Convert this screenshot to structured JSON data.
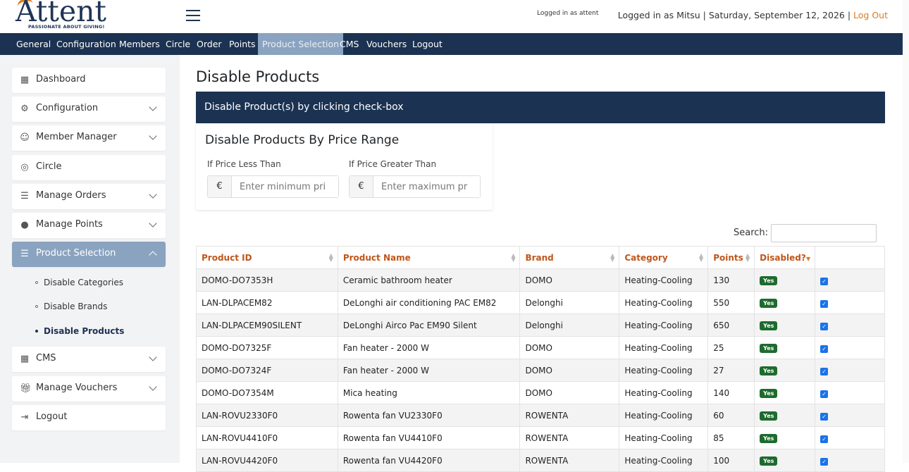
{
  "header": {
    "logo_word": "Attent",
    "logo_tagline": "PASSIONATE ABOUT GIVING!",
    "logged_small": "Logged in as attent",
    "logged_in_text": "Logged in as Mitsu | Saturday, September 12, 2026 |",
    "logout_link": "Log Out"
  },
  "nav": {
    "items": [
      "General",
      "Configuration",
      "Members",
      "Circle",
      "Order",
      "Points",
      "Product Selection",
      "CMS",
      "Vouchers",
      "Logout"
    ],
    "active": "Product Selection"
  },
  "sidebar": {
    "items": [
      {
        "label": "Dashboard",
        "icon": "grid-icon"
      },
      {
        "label": "Configuration",
        "icon": "gear-icon"
      },
      {
        "label": "Member Manager",
        "icon": "user-icon"
      },
      {
        "label": "Circle",
        "icon": "target-icon"
      },
      {
        "label": "Manage Orders",
        "icon": "list-icon"
      },
      {
        "label": "Manage Points",
        "icon": "coins-icon"
      },
      {
        "label": "Product Selection",
        "icon": "list-icon"
      },
      {
        "label": "CMS",
        "icon": "grid-icon"
      },
      {
        "label": "Manage Vouchers",
        "icon": "gift-icon"
      },
      {
        "label": "Logout",
        "icon": "logout-icon"
      }
    ],
    "sub_items": [
      "Disable Categories",
      "Disable Brands",
      "Disable Products"
    ]
  },
  "main": {
    "title": "Disable Products",
    "card_header": "Disable Product(s) by clicking check-box",
    "range": {
      "title": "Disable Products By Price Range",
      "less_label": "If Price Less Than",
      "greater_label": "If Price Greater Than",
      "currency": "€",
      "min_placeholder": "Enter minimum pri",
      "max_placeholder": "Enter maximum pr"
    },
    "search_label": "Search:",
    "columns": [
      "Product ID",
      "Product Name",
      "Brand",
      "Category",
      "Points",
      "Disabled?",
      ""
    ],
    "rows": [
      {
        "id": "DOMO-DO7353H",
        "name": "Ceramic bathroom heater",
        "brand": "DOMO",
        "category": "Heating-Cooling",
        "points": "130",
        "disabled": "Yes"
      },
      {
        "id": "LAN-DLPACEM82",
        "name": "DeLonghi air conditioning PAC EM82",
        "brand": "Delonghi",
        "category": "Heating-Cooling",
        "points": "550",
        "disabled": "Yes"
      },
      {
        "id": "LAN-DLPACEM90SILENT",
        "name": "DeLonghi Airco Pac EM90 Silent",
        "brand": "Delonghi",
        "category": "Heating-Cooling",
        "points": "650",
        "disabled": "Yes"
      },
      {
        "id": "DOMO-DO7325F",
        "name": "Fan heater - 2000 W",
        "brand": "DOMO",
        "category": "Heating-Cooling",
        "points": "25",
        "disabled": "Yes"
      },
      {
        "id": "DOMO-DO7324F",
        "name": "Fan heater - 2000 W",
        "brand": "DOMO",
        "category": "Heating-Cooling",
        "points": "27",
        "disabled": "Yes"
      },
      {
        "id": "DOMO-DO7354M",
        "name": "Mica heating",
        "brand": "DOMO",
        "category": "Heating-Cooling",
        "points": "140",
        "disabled": "Yes"
      },
      {
        "id": "LAN-ROVU2330F0",
        "name": "Rowenta fan VU2330F0",
        "brand": "ROWENTA",
        "category": "Heating-Cooling",
        "points": "60",
        "disabled": "Yes"
      },
      {
        "id": "LAN-ROVU4410F0",
        "name": "Rowenta fan VU4410F0",
        "brand": "ROWENTA",
        "category": "Heating-Cooling",
        "points": "85",
        "disabled": "Yes"
      },
      {
        "id": "LAN-ROVU4420F0",
        "name": "Rowenta fan VU4420F0",
        "brand": "ROWENTA",
        "category": "Heating-Cooling",
        "points": "100",
        "disabled": "Yes"
      }
    ]
  }
}
